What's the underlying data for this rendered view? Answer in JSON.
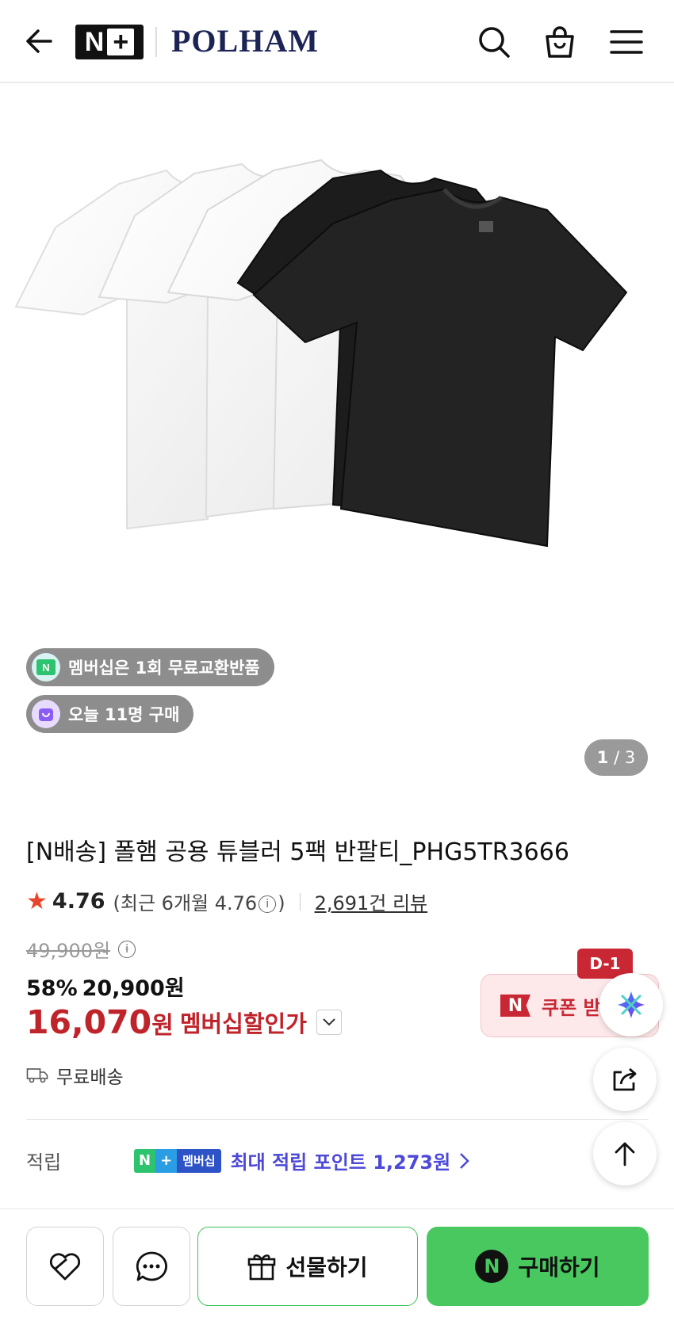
{
  "header": {
    "np_logo_n": "N",
    "np_logo_plus": "+",
    "brand": "POLHAM"
  },
  "badges": {
    "membership_exchange": "멤버십은 1회 무료교환반품",
    "today_purchases": "오늘 11명 구매"
  },
  "gallery": {
    "current": "1",
    "total": "/ 3"
  },
  "product": {
    "title": "[N배송] 폴햄 공용 튜블러 5팩 반팔티_PHG5TR3666",
    "rating": "4.76",
    "rating_detail_pre": "(최근 6개월 4.76",
    "rating_detail_post": ")",
    "review_count": "2,691건 리뷰",
    "original_price": "49,900원",
    "discount_rate": "58%",
    "sale_price": "20,900원",
    "member_price_number": "16,070",
    "member_price_unit": "원",
    "member_price_label": "멤버십할인가",
    "delivery": "무료배송"
  },
  "points": {
    "label": "적립",
    "badge_n": "N",
    "badge_plus": "+",
    "badge_text": "멤버십",
    "text": "최대 적립 포인트 1,273원"
  },
  "coupon": {
    "dday": "D-1",
    "icon_text": "N",
    "text": "쿠폰 받"
  },
  "actions": {
    "gift": "선물하기",
    "buy_icon": "N",
    "buy": "구매하기"
  },
  "colors": {
    "brand_navy": "#1c2456",
    "member_red": "#c0242b",
    "point_purple": "#4c48d8",
    "buy_green": "#49c85f"
  }
}
